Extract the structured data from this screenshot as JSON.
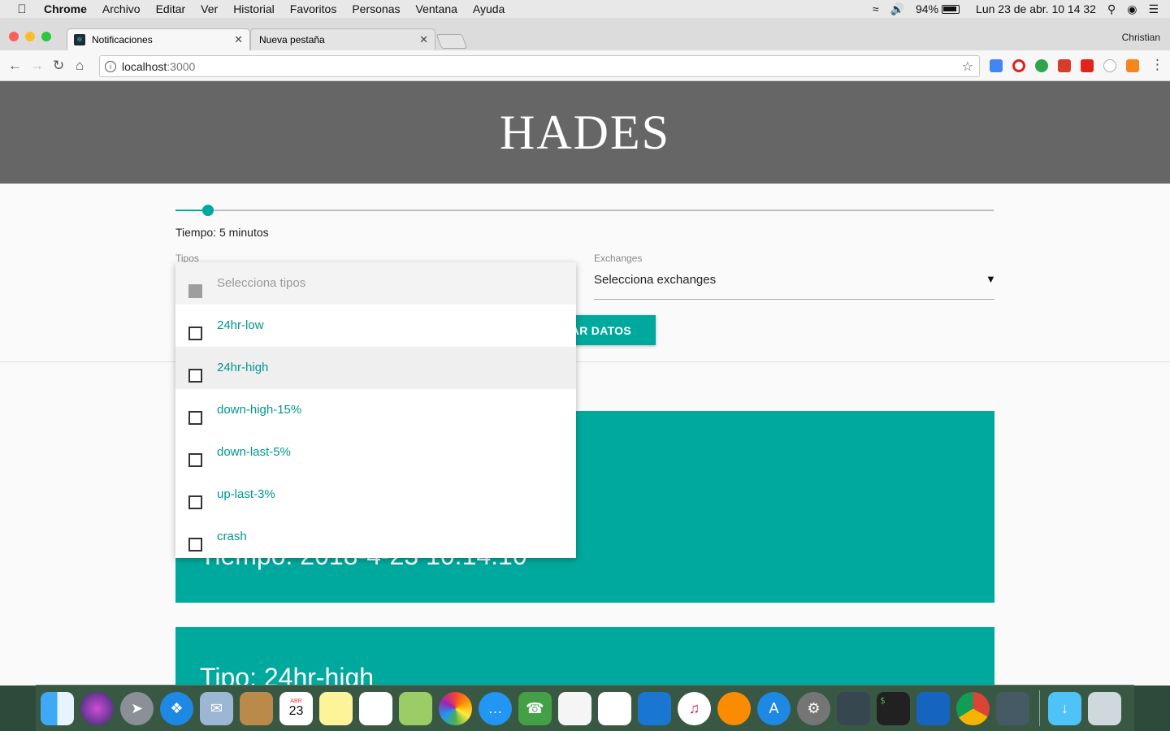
{
  "menubar": {
    "app": "Chrome",
    "items": [
      "Archivo",
      "Editar",
      "Ver",
      "Historial",
      "Favoritos",
      "Personas",
      "Ventana",
      "Ayuda"
    ],
    "battery": "94%",
    "clock": "Lun 23 de abr.  10 14 32"
  },
  "browser": {
    "tabs": [
      {
        "title": "Notificaciones",
        "active": true
      },
      {
        "title": "Nueva pestaña",
        "active": false
      }
    ],
    "profile": "Christian",
    "url_host": "localhost",
    "url_port": ":3000"
  },
  "page": {
    "title": "HADES",
    "slider": {
      "value_fraction": 0.04
    },
    "time_label": "Tiempo: 5 minutos",
    "tipos_label": "Tipos",
    "exchanges_label": "Exchanges",
    "exchanges_value": "Selecciona exchanges",
    "load_button": "AR DATOS",
    "dropdown": {
      "placeholder": "Selecciona tipos",
      "options": [
        "24hr-low",
        "24hr-high",
        "down-high-15%",
        "down-last-5%",
        "up-last-3%",
        "crash"
      ],
      "hovered_index": 1
    },
    "cards": [
      {
        "title": "Tiempo: 2018-4-23 10:14:10"
      },
      {
        "title": "Tipo: 24hr-high"
      }
    ]
  },
  "colors": {
    "accent": "#00a99d",
    "header_bg": "#666666"
  },
  "dock": {
    "icons": [
      "finder-icon",
      "siri-icon",
      "launchpad-icon",
      "safari-icon",
      "mail-icon",
      "contacts-icon",
      "calendar-icon",
      "notes-icon",
      "reminders-icon",
      "maps-icon",
      "photos-icon",
      "messages-icon",
      "facetime-icon",
      "keynote-alt-icon",
      "numbers-icon",
      "keynote-icon",
      "itunes-icon",
      "ibooks-icon",
      "appstore-icon",
      "system-preferences-icon",
      "activity-icon",
      "terminal-icon",
      "vscode-icon",
      "chrome-icon",
      "instruments-icon",
      "downloads-icon",
      "trash-icon"
    ],
    "calendar_month": "ABR",
    "calendar_day": "23"
  }
}
